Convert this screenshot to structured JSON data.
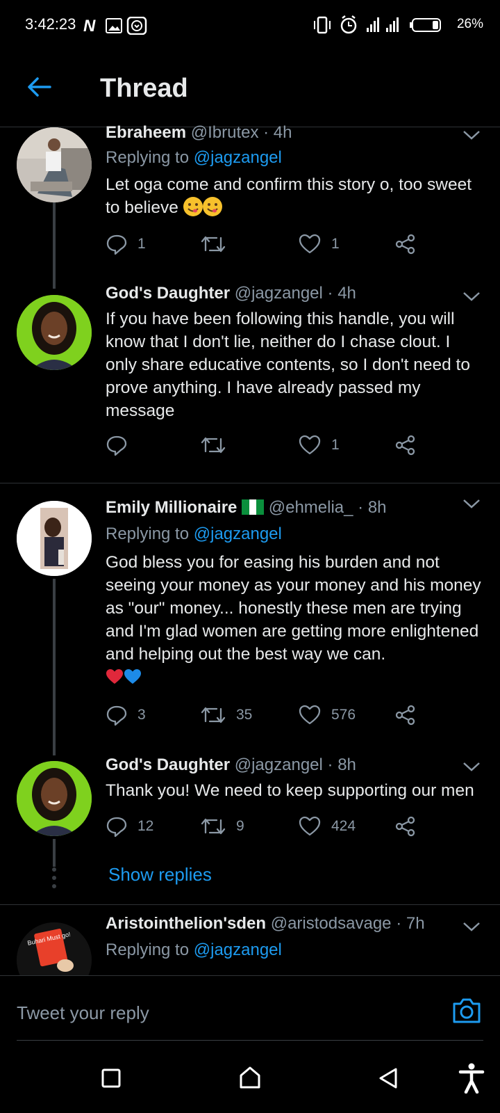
{
  "status_bar": {
    "time": "3:42:23",
    "battery": "26%"
  },
  "header": {
    "title": "Thread"
  },
  "tweets": [
    {
      "name": "Ebraheem",
      "handle": "@Ibrutex",
      "time": "· 4h",
      "replying_prefix": "Replying to ",
      "replying_handle": "@jagzangel",
      "text": "Let oga come and confirm this story o, too sweet to believe",
      "replies": "1",
      "retweets": "",
      "likes": "1"
    },
    {
      "name": "God's Daughter",
      "handle": "@jagzangel",
      "time": "· 4h",
      "text": "If you have been following this handle, you will know that I don't lie, neither do I chase clout. I only share educative contents, so I don't need to prove anything. I have already passed my message",
      "replies": "",
      "retweets": "",
      "likes": "1"
    },
    {
      "name": "Emily Millionaire",
      "handle": "@ehmelia_",
      "time": "· 8h",
      "replying_prefix": "Replying to ",
      "replying_handle": "@jagzangel",
      "text": "God bless you for easing his burden and not seeing your money as your money and his money as \"our\" money... honestly these men are trying and I'm glad women are getting more enlightened and helping out the best way we can.",
      "replies": "3",
      "retweets": "35",
      "likes": "576"
    },
    {
      "name": "God's Daughter",
      "handle": "@jagzangel",
      "time": "· 8h",
      "text": "Thank you! We need to keep supporting our men",
      "replies": "12",
      "retweets": "9",
      "likes": "424"
    },
    {
      "name": "Aristointhelion'sden",
      "handle": "@aristodsavage",
      "time": "· 7h",
      "replying_prefix": "Replying to ",
      "replying_handle": "@jagzangel",
      "avatar_text": "Buhari Must go!"
    }
  ],
  "show_replies": "Show replies",
  "reply_bar": {
    "placeholder": "Tweet your reply"
  },
  "colors": {
    "accent": "#1d9bf0",
    "background": "#000000",
    "muted": "#8b98a5"
  }
}
